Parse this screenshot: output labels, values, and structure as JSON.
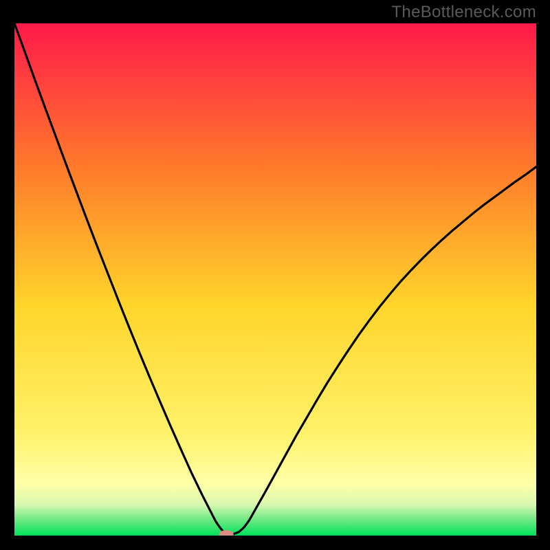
{
  "watermark": "TheBottleneck.com",
  "colors": {
    "gradient_top": "#ff1a4a",
    "gradient_mid_upper": "#ff8a2b",
    "gradient_mid": "#ffd52b",
    "gradient_lower": "#fff26a",
    "gradient_pale": "#ffffa8",
    "gradient_green_light": "#9ff59a",
    "gradient_green": "#00e05a",
    "curve_stroke": "#000000",
    "marker_fill": "#d98b86"
  },
  "chart_data": {
    "type": "line",
    "title": "",
    "xlabel": "",
    "ylabel": "",
    "xlim": [
      0,
      100
    ],
    "ylim": [
      0,
      100
    ],
    "x": [
      0,
      2,
      4,
      6,
      8,
      10,
      12,
      14,
      16,
      18,
      20,
      22,
      24,
      26,
      28,
      30,
      32,
      34,
      36,
      38,
      38.5,
      39,
      39.5,
      40,
      40.5,
      41,
      42,
      43,
      44,
      45,
      46,
      48,
      50,
      52,
      54,
      56,
      58,
      60,
      62,
      64,
      66,
      68,
      70,
      72,
      74,
      76,
      78,
      80,
      82,
      84,
      86,
      88,
      90,
      92,
      94,
      96,
      98,
      100
    ],
    "y": [
      100,
      94.4,
      88.75,
      83.2,
      77.7,
      72.2,
      66.8,
      61.4,
      56.1,
      50.9,
      45.7,
      40.6,
      35.6,
      30.7,
      25.9,
      21.2,
      16.6,
      12.1,
      7.9,
      3.9,
      2.9,
      2.1,
      1.4,
      0.8,
      0.45,
      0.3,
      0.3,
      0.7,
      1.6,
      3.0,
      4.8,
      8.4,
      12.1,
      15.8,
      19.5,
      23.0,
      26.5,
      29.9,
      33.1,
      36.2,
      39.2,
      42.0,
      44.7,
      47.2,
      49.6,
      51.8,
      53.9,
      55.9,
      57.8,
      59.6,
      61.3,
      63.0,
      64.6,
      66.1,
      67.6,
      69.1,
      70.5,
      72.0
    ],
    "gradient_stops": [
      {
        "offset": 0.0,
        "color": "#ff1a4a"
      },
      {
        "offset": 0.28,
        "color": "#ff7a2b"
      },
      {
        "offset": 0.55,
        "color": "#ffd52b"
      },
      {
        "offset": 0.8,
        "color": "#fff26a"
      },
      {
        "offset": 0.9,
        "color": "#ffffa8"
      },
      {
        "offset": 0.94,
        "color": "#d8f8b0"
      },
      {
        "offset": 0.965,
        "color": "#7ceb8a"
      },
      {
        "offset": 1.0,
        "color": "#00e05a"
      }
    ],
    "marker": {
      "x": 40.6,
      "y": 0.25,
      "rx": 1.4,
      "ry": 0.8
    }
  }
}
